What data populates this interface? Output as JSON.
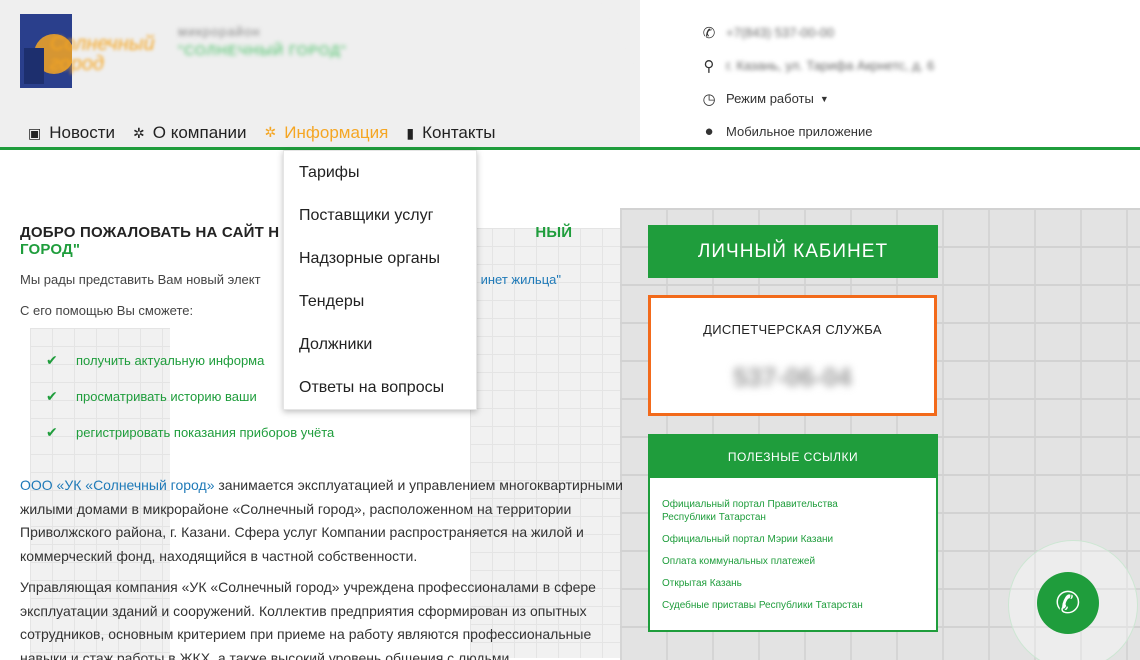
{
  "header": {
    "logo_text": "Солнечный город",
    "site_title_line1": "микрорайон",
    "site_title_line2": "\"СОЛНЕЧНЫЙ ГОРОД\"",
    "contacts": {
      "phone": "+7(843) 537-00-00",
      "address": "г. Казань, ул. Тарифа Акрнетс, д. 6",
      "hours_label": "Режим работы",
      "mobile_app_label": "Мобильное приложение"
    }
  },
  "nav": {
    "items": [
      {
        "label": "Новости",
        "icon": "newspaper-icon"
      },
      {
        "label": "О компании",
        "icon": "gear-icon"
      },
      {
        "label": "Информация",
        "icon": "gear-icon",
        "active": true
      },
      {
        "label": "Контакты",
        "icon": "contact-book-icon"
      }
    ]
  },
  "dropdown": {
    "items": [
      "Тарифы",
      "Поставщики услуг",
      "Надзорные органы",
      "Тендеры",
      "Должники",
      "Ответы на вопросы"
    ]
  },
  "main": {
    "welcome": "ДОБРО ПОЖАЛОВАТЬ НА САЙТ Н",
    "welcome_tail": "НЫЙ ГОРОД\"",
    "intro": "Мы рады представить Вам новый элект",
    "intro_link_tail": "инет жильца\"",
    "can_label": "С его помощью Вы сможете:",
    "features": [
      "получить актуальную информа",
      "просматривать историю ваши",
      "регистрировать показания приборов учёта"
    ],
    "about_org": "ООО «УК «Солнечный город»",
    "about_text": " занимается эксплуатацией и управлением многоквартирными жилыми домами в микрорайоне «Солнечный город», расположенном на территории Приволжского района, г. Казани. Сфера услуг Компании распространяется на жилой и коммерческий фонд, находящийся в частной собственности.",
    "about2": "Управляющая компания «УК «Солнечный город» учреждена профессионалами в сфере эксплуатации зданий и сооружений. Коллектив предприятия сформирован из опытных сотрудников, основным критерием при приеме на работу являются профессиональные навыки и стаж работы в ЖКХ, а также высокий уровень общения с людьми."
  },
  "sidebar": {
    "cabinet_label": "Личный кабинет",
    "dispatch_title": "ДИСПЕТЧЕРСКАЯ СЛУЖБА",
    "dispatch_phone": "537-06-04",
    "links_title": "ПОЛЕЗНЫЕ ССЫЛКИ",
    "links": [
      "Официальный портал Правительства Республики Татарстан",
      "Официальный портал Мэрии Казани",
      "Оплата коммунальных платежей",
      "Открытая Казань",
      "Судебные приставы Республики Татарстан"
    ]
  },
  "colors": {
    "accent_green": "#1f9d3c",
    "accent_orange": "#f5a623",
    "dispatch_border": "#f26a1b"
  }
}
